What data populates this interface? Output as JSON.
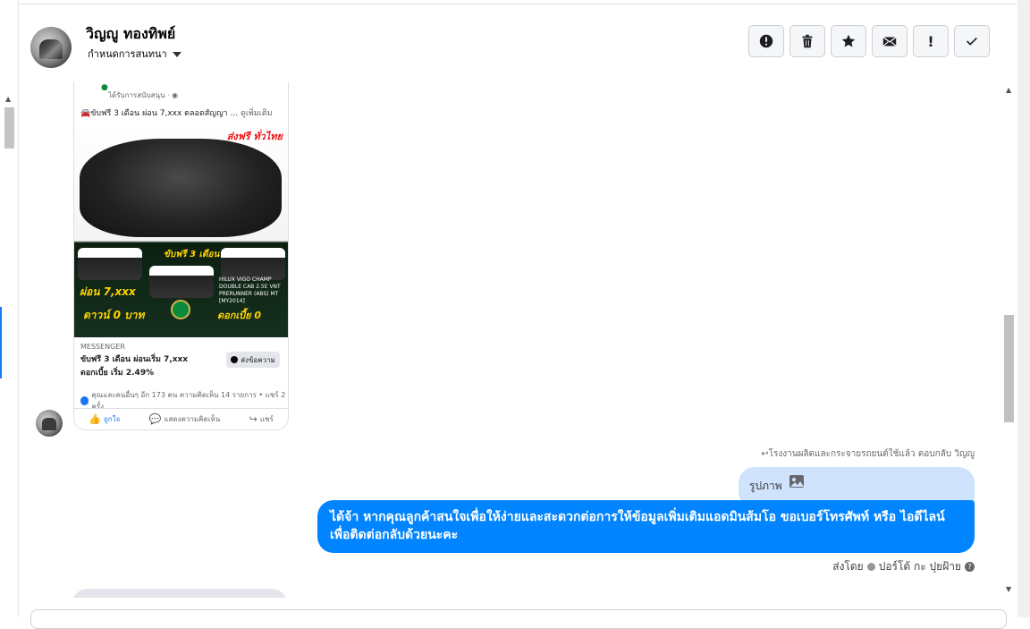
{
  "header": {
    "user_name": "วิญญู ทองทิพย์",
    "conversation_menu": "กำหนดการสนทนา",
    "actions": [
      {
        "name": "report-button",
        "icon": "alert-circle-icon"
      },
      {
        "name": "delete-button",
        "icon": "trash-icon"
      },
      {
        "name": "star-button",
        "icon": "star-icon"
      },
      {
        "name": "mark-unread-button",
        "icon": "envelope-icon"
      },
      {
        "name": "spam-button",
        "icon": "exclamation-icon",
        "label": "!"
      },
      {
        "name": "done-button",
        "icon": "check-icon"
      }
    ]
  },
  "post": {
    "sponsored": "ได้รับการสนับสนุน · ",
    "text": "🚘ขับฟรี 3 เดือน ผ่อน 7,xxx ตลอดสัญญา ...",
    "see_more": "ดูเพิ่มเติม",
    "image": {
      "free_ship": "ส่งฟรี ทั่วไทย",
      "promo_drive": "ขับฟรี 3 เดือน",
      "promo_installment": "ผ่อน 7,xxx",
      "promo_down": "ดาวน์ 0 บาท",
      "promo_interest": "ดอกเบี้ย 0",
      "model": "HILUX VIGO CHAMP DOUBLE CAB 2.5E VNT PRERUNNER (ABS) MT [MY2014]"
    },
    "cta_source": "MESSENGER",
    "cta_title": "ขับฟรี 3 เดือน ผ่อนเริ่ม 7,xxx ดอกเบี้ย เริ่ม 2.49%",
    "cta_button": "ส่งข้อความ",
    "reactions": "คุณและคนอื่นๆ อีก 173 คน ความคิดเห็น 14 รายการ • แชร์ 2 ครั้ง",
    "actions": {
      "like": "ถูกใจ",
      "comment": "แสดงความคิดเห็น",
      "share": "แชร์"
    }
  },
  "messages": {
    "reply_context": "โรงงานผลิตและกระจายรถยนต์ใช้แล้ว ตอบกลับ วิญญู",
    "image_label": "รูปภาพ",
    "reply_text": "ได้จ้า หากคุณลูกค้าสนใจเพื่อให้ง่ายและสะดวกต่อการให้ข้อมูลเพิ่มเติมแอดมินส้มโอ ขอเบอร์โทรศัพท์ หรือ ไอดีไลน์ เพื่อติดต่อกลับด้วยนะคะ",
    "sent_by_prefix": "ส่งโดย",
    "sent_by_name": "ปอร์โต้ กะ ปุยฝ้าย"
  }
}
